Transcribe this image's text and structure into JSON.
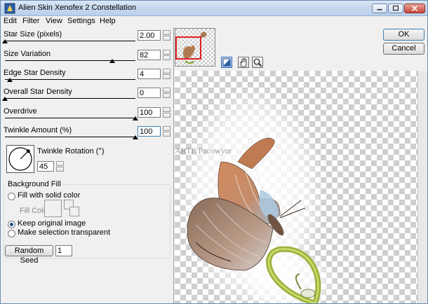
{
  "window": {
    "title": "Alien Skin Xenofex 2 Constellation"
  },
  "menu": [
    "Edit",
    "Filter",
    "View",
    "Settings",
    "Help"
  ],
  "params": {
    "star_size": {
      "label": "Star Size (pixels)",
      "value": "2.00",
      "level": 0.0
    },
    "size_variation": {
      "label": "Size Variation",
      "value": "82",
      "level": 0.82
    },
    "edge_density": {
      "label": "Edge Star Density",
      "value": "4",
      "level": 0.04
    },
    "overall_density": {
      "label": "Overall Star Density",
      "value": "0",
      "level": 0.0
    },
    "overdrive": {
      "label": "Overdrive",
      "value": "100",
      "level": 1.0
    },
    "twinkle": {
      "label": "Twinkle Amount (%)",
      "value": "100",
      "level": 1.0
    }
  },
  "rotation": {
    "label": "Twinkle Rotation (°)",
    "value": "45"
  },
  "background_fill": {
    "legend": "Background Fill",
    "options": [
      "Fill with solid color",
      "Keep original image",
      "Make selection transparent"
    ],
    "selected": "Keep original image",
    "fill_color_label": "Fill Color"
  },
  "seed": {
    "button_label": "Random Seed",
    "value": "1"
  },
  "buttons": {
    "ok": "OK",
    "cancel": "Cancel"
  },
  "tools": [
    "preview-compare-icon",
    "hand-icon",
    "zoom-icon"
  ],
  "watermark": "ARTE Pacowyor",
  "colors": {
    "accent": "#3c7fb1",
    "titlebar": "#c6d8ee",
    "close": "#c8463a"
  }
}
